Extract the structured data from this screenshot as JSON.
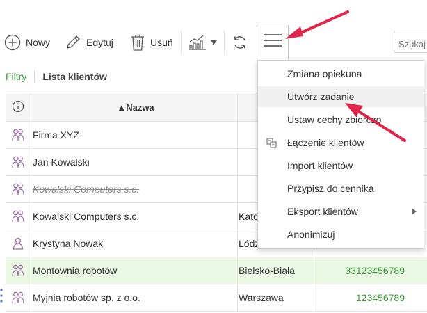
{
  "toolbar": {
    "new_label": "Nowy",
    "edit_label": "Edytuj",
    "delete_label": "Usuń",
    "search_placeholder": "Szukaj"
  },
  "filterbar": {
    "filters_label": "Filtry",
    "title": "Lista klientów"
  },
  "table": {
    "columns": {
      "name": "▲Nazwa"
    },
    "rows": [
      {
        "name": "Firma XYZ",
        "city": "",
        "phone": "",
        "icon": "group-icon",
        "deleted": false
      },
      {
        "name": "Jan Kowalski",
        "city": "",
        "phone": "",
        "icon": "group-icon",
        "deleted": false
      },
      {
        "name": "Kowalski Computers s.c.",
        "city": "",
        "phone": "",
        "icon": "group-icon",
        "deleted": true
      },
      {
        "name": "Kowalski Computers s.c.",
        "city": "Kato",
        "phone": "",
        "icon": "group-icon",
        "deleted": false
      },
      {
        "name": "Krystyna Nowak",
        "city": "Łódź",
        "phone": "",
        "icon": "person-icon",
        "deleted": false
      },
      {
        "name": "Montownia robotów",
        "city": "Bielsko-Biała",
        "phone": "33123456789",
        "icon": "group-icon",
        "deleted": false
      },
      {
        "name": "Myjnia robotów sp. z o.o.",
        "city": "Warszawa",
        "phone": "123456789",
        "icon": "group-icon",
        "deleted": false
      }
    ]
  },
  "menu": {
    "items": [
      {
        "label": "Zmiana opiekuna"
      },
      {
        "label": "Utwórz zadanie"
      },
      {
        "label": "Ustaw cechy zbiorczo"
      },
      {
        "label": "Łączenie klientów"
      },
      {
        "label": "Import klientów"
      },
      {
        "label": "Przypisz do cennika"
      },
      {
        "label": "Eksport klientów"
      },
      {
        "label": "Anonimizuj"
      }
    ]
  },
  "colors": {
    "accent_green": "#3a9b3a",
    "row_highlight": "#e9f7e3",
    "annotation_arrow": "#e0264a"
  }
}
